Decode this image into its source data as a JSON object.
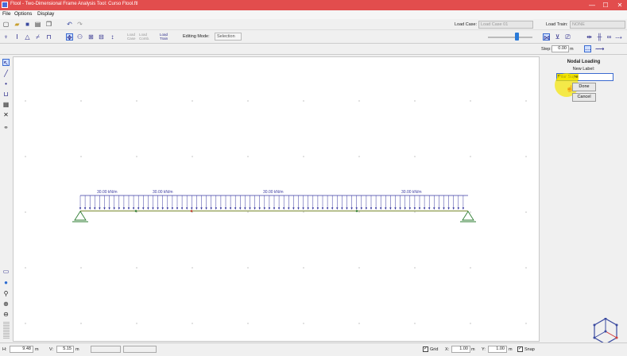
{
  "titlebar": {
    "title": "Ftool - Two-Dimensional Frame Analysis Tool: Curso Ftool.ftl",
    "minimize": "—",
    "maximize": "☐",
    "close": "✕"
  },
  "menu": {
    "file": "File",
    "options": "Options",
    "display": "Display"
  },
  "toolbar1": {
    "load_case_label": "Load Case:",
    "load_case_value": "Load Case 01",
    "load_train_label": "Load Train:",
    "load_train_value": "NONE"
  },
  "toolbar2": {
    "load_case_small": "Load\nCase",
    "load_comb_small": "Load\nComb.",
    "load_train_small": "Load\nTrain",
    "editing_mode_label": "Editing Mode:",
    "editing_mode_value": "Selection"
  },
  "stepbar": {
    "step_label": "Step:",
    "step_value": "0.00",
    "step_unit": "m"
  },
  "panel": {
    "heading": "Nodal Loading",
    "new_label_caption": "New Label:",
    "new_label_value": "Pilar Supe",
    "done": "Done",
    "cancel": "Cancel"
  },
  "beam": {
    "load_labels": [
      "30.00 kN/m",
      "30.00 kN/m",
      "30.00 kN/m",
      "30.00 kN/m"
    ]
  },
  "status": {
    "h_label": "H:",
    "h_value": "9.48",
    "h_unit": "m",
    "v_label": "V:",
    "v_value": "5.15",
    "v_unit": "m",
    "x_label": "X:",
    "y_label": "Y:",
    "grid_label": "Grid",
    "x_step_label": "X:",
    "x_step_value": "1.00",
    "x_step_unit": "m",
    "y_step_label": "Y:",
    "y_step_value": "1.00",
    "y_step_unit": "m",
    "snap_label": "Snap"
  },
  "colors": {
    "titlebar": "#e24d4d",
    "highlight": "#f5e600",
    "load": "#3a3aa0",
    "beam": "#7a8a30",
    "support": "#2e7d32"
  }
}
